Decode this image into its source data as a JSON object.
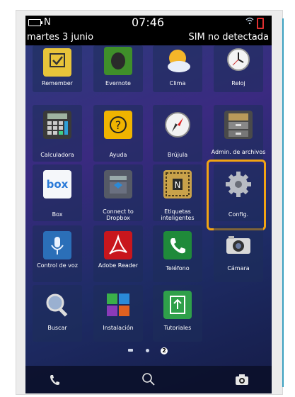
{
  "statusbar": {
    "time": "07:46",
    "nfc_glyph": "N",
    "icons": [
      "battery-icon",
      "nfc-icon",
      "wifi-icon",
      "battery-alert-icon"
    ]
  },
  "infobar": {
    "date": "martes 3 junio",
    "sim": "SIM no detectada"
  },
  "apps": {
    "remember": "Remember",
    "evernote": "Evernote",
    "clima": "Clima",
    "reloj": "Reloj",
    "calculadora": "Calculadora",
    "ayuda": "Ayuda",
    "brujula": "Brújula",
    "admin": "Admin. de archivos",
    "box": "Box",
    "box_logo": "box",
    "dropbox": "Connect to Dropbox",
    "etiquetas": "Etiquetas inteligentes",
    "config": "Config.",
    "voz": "Control de voz",
    "adobe": "Adobe Reader",
    "telefono": "Teléfono",
    "camara": "Cámara",
    "buscar": "Buscar",
    "instalacion": "Instalación",
    "tutoriales": "Tutoriales"
  },
  "pager": {
    "current": "2"
  },
  "dock": {
    "icons": [
      "phone-icon",
      "search-icon",
      "camera-icon"
    ]
  },
  "colors": {
    "highlight": "#f2a413",
    "screen_bg": "#2b3d7c"
  }
}
